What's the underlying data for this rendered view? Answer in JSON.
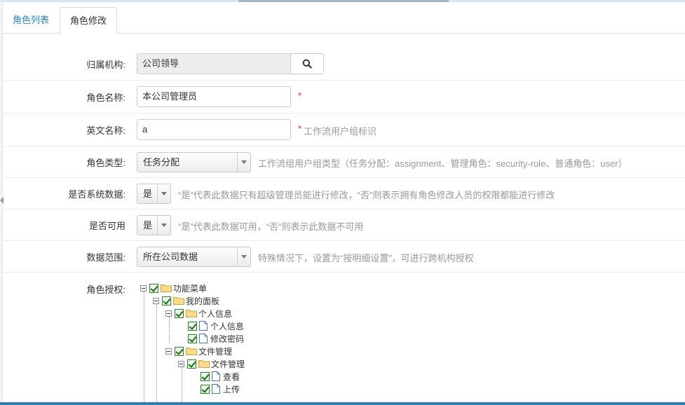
{
  "tabs": [
    {
      "label": "角色列表"
    },
    {
      "label": "角色修改"
    }
  ],
  "form": {
    "org": {
      "label": "归属机构:",
      "value": "公司领导"
    },
    "role_name": {
      "label": "角色名称:",
      "value": "本公司管理员",
      "required": "*"
    },
    "english_name": {
      "label": "英文名称:",
      "value": "a",
      "required": "*",
      "help": "工作流用户组标识"
    },
    "role_type": {
      "label": "角色类型:",
      "value": "任务分配",
      "help": "工作流组用户组类型（任务分配：assignment、管理角色：security-role、普通角色：user）"
    },
    "is_system": {
      "label": "是否系统数据:",
      "value": "是",
      "help": "“是”代表此数据只有超级管理员能进行修改，“否”则表示拥有角色修改人员的权限都能进行修改"
    },
    "is_usable": {
      "label": "是否可用",
      "value": "是",
      "help": "“是”代表此数据可用，“否”则表示此数据不可用"
    },
    "data_scope": {
      "label": "数据范围:",
      "value": "所在公司数据",
      "help": "特殊情况下，设置为“按明细设置”，可进行跨机构授权"
    },
    "permission": {
      "label": "角色授权:"
    }
  },
  "tree": [
    {
      "label": "功能菜单",
      "type": "folder"
    },
    {
      "label": "我的面板",
      "type": "folder"
    },
    {
      "label": "个人信息",
      "type": "folder"
    },
    {
      "label": "个人信息",
      "type": "file"
    },
    {
      "label": "修改密码",
      "type": "file"
    },
    {
      "label": "文件管理",
      "type": "folder"
    },
    {
      "label": "文件管理",
      "type": "folder"
    },
    {
      "label": "查看",
      "type": "file"
    },
    {
      "label": "上传",
      "type": "file"
    }
  ],
  "colors": {
    "accent": "#2a8ac2",
    "required": "#e02b27",
    "bottom_bar": "#2f7fae"
  }
}
